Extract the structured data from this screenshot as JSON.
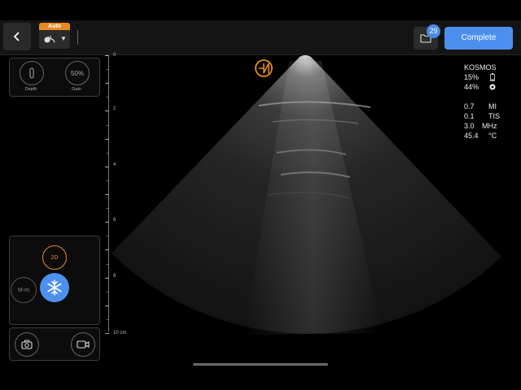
{
  "topbar": {
    "auto_badge": "Auto",
    "folder_count": "29",
    "complete_label": "Complete"
  },
  "imaging_panel": {
    "depth_label": "Depth",
    "gain_value": "50%",
    "gain_label": "Gain"
  },
  "mode_panel": {
    "mode_2d": "2D",
    "mode_m": "M-m",
    "freeze_icon": "snowflake-icon"
  },
  "capture_panel": {
    "photo_icon": "camera-icon",
    "video_icon": "video-camera-icon"
  },
  "depth_scale": {
    "labels": [
      "0",
      "2",
      "4",
      "6",
      "8",
      "10 cm"
    ]
  },
  "device_info": {
    "device_name": "KOSMOS",
    "battery": "15%",
    "probe_battery": "44%",
    "mi_value": "0.7",
    "mi_label": "MI",
    "tis_value": "0.1",
    "tis_label": "TIS",
    "freq_value": "3.0",
    "freq_label": "MHz",
    "temp_value": "45.4",
    "temp_label": "°C"
  },
  "colors": {
    "accent_blue": "#4d8fef",
    "accent_orange": "#e58a1f"
  }
}
